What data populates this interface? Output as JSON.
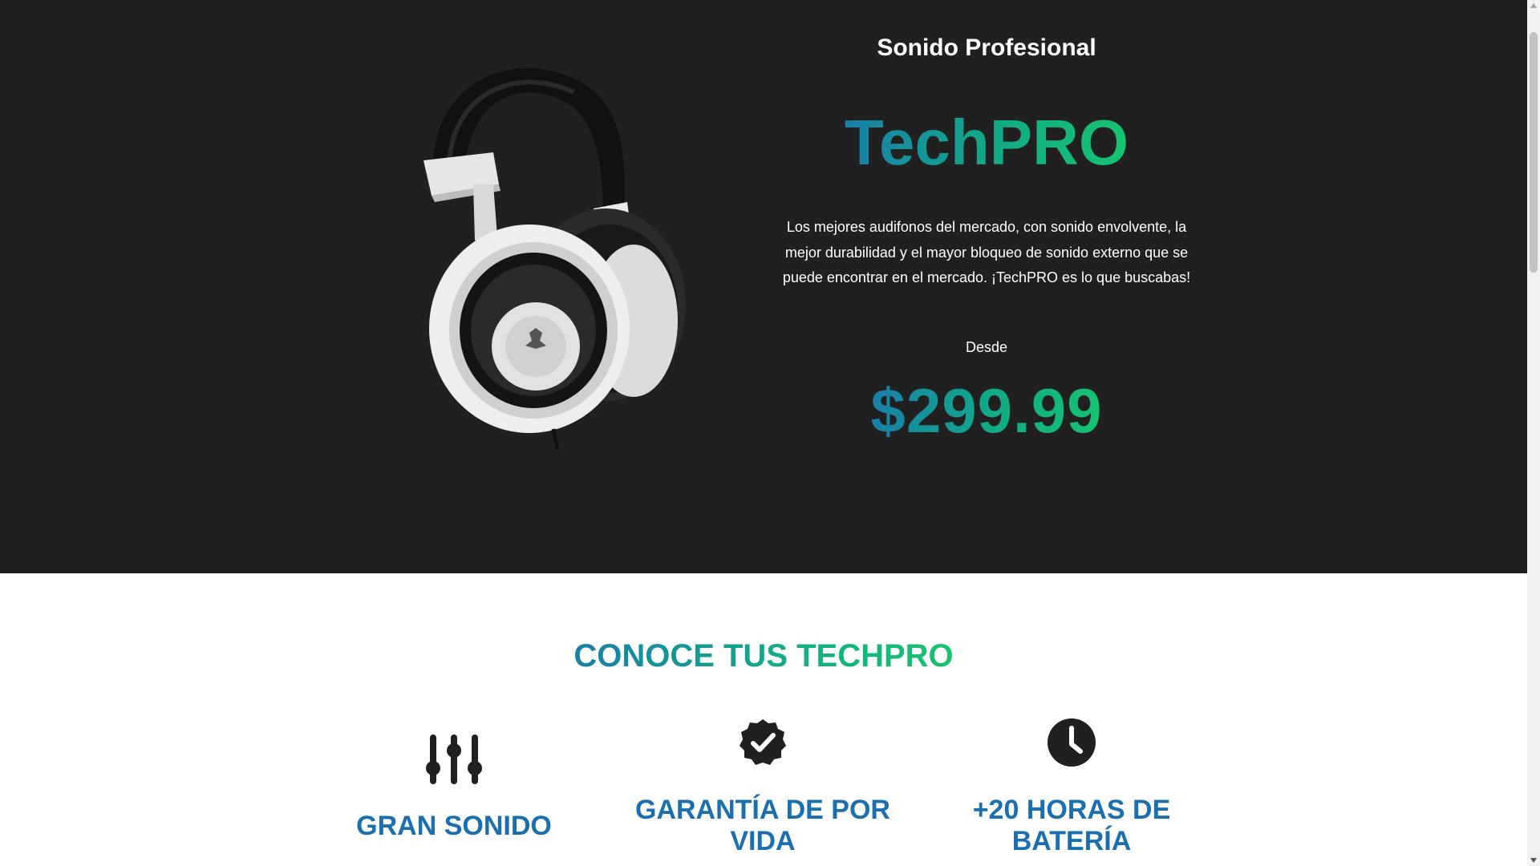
{
  "hero": {
    "tagline": "Sonido Profesional",
    "brand": "TechPRO",
    "description": "Los mejores audifonos del mercado, con sonido envolvente, la mejor durabilidad y el mayor bloqueo de sonido externo que se puede encontrar en el mercado. ¡TechPRO es lo que buscabas!",
    "price_prefix": "Desde",
    "price": "$299.99",
    "image": "headphones-image"
  },
  "features_section": {
    "title": "CONOCE TUS TECHPRO",
    "items": [
      {
        "icon": "equalizer-sliders-icon",
        "title": "GRAN SONIDO"
      },
      {
        "icon": "verified-badge-check-icon",
        "title": "GARANTÍA DE POR VIDA"
      },
      {
        "icon": "clock-icon",
        "title": "+20 HORAS DE BATERÍA"
      }
    ]
  },
  "colors": {
    "hero_background": "#202020",
    "gradient_start": "#1a7fa8",
    "gradient_end": "#16c46e",
    "feature_title": "#1b6fae",
    "icon": "#202020"
  }
}
